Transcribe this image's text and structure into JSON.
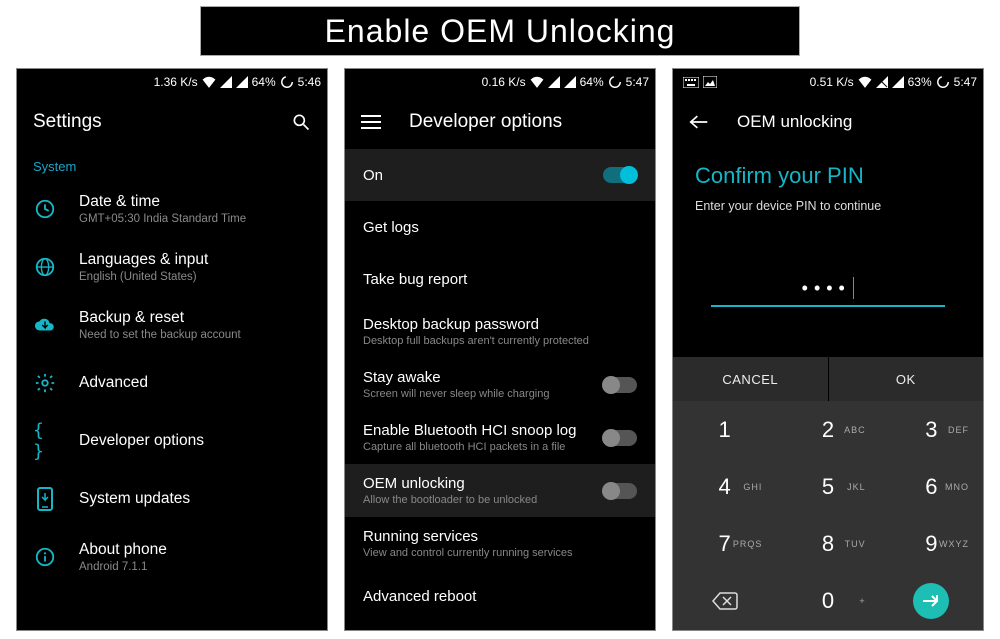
{
  "banner": {
    "title": "Enable OEM Unlocking"
  },
  "accent": "#15b6c7",
  "screen1": {
    "status": {
      "speed": "1.36 K/s",
      "battery": "64%",
      "time": "5:46"
    },
    "title": "Settings",
    "section": "System",
    "items": [
      {
        "label": "Date & time",
        "sub": "GMT+05:30 India Standard Time",
        "icon": "clock-icon"
      },
      {
        "label": "Languages & input",
        "sub": "English (United States)",
        "icon": "globe-icon"
      },
      {
        "label": "Backup & reset",
        "sub": "Need to set the backup account",
        "icon": "cloud-icon"
      },
      {
        "label": "Advanced",
        "sub": "",
        "icon": "gear-icon"
      },
      {
        "label": "Developer options",
        "sub": "",
        "icon": "braces-icon"
      },
      {
        "label": "System updates",
        "sub": "",
        "icon": "update-icon"
      },
      {
        "label": "About phone",
        "sub": "Android 7.1.1",
        "icon": "info-icon"
      }
    ]
  },
  "screen2": {
    "status": {
      "speed": "0.16 K/s",
      "battery": "64%",
      "time": "5:47"
    },
    "title": "Developer options",
    "items": [
      {
        "label": "On",
        "sub": "",
        "toggle": "on",
        "highlight": true
      },
      {
        "label": "Get logs",
        "sub": ""
      },
      {
        "label": "Take bug report",
        "sub": ""
      },
      {
        "label": "Desktop backup password",
        "sub": "Desktop full backups aren't currently protected"
      },
      {
        "label": "Stay awake",
        "sub": "Screen will never sleep while charging",
        "toggle": "off"
      },
      {
        "label": "Enable Bluetooth HCI snoop log",
        "sub": "Capture all bluetooth HCI packets in a file",
        "toggle": "off"
      },
      {
        "label": "OEM unlocking",
        "sub": "Allow the bootloader to be unlocked",
        "toggle": "off",
        "highlight": true
      },
      {
        "label": "Running services",
        "sub": "View and control currently running services"
      },
      {
        "label": "Advanced reboot",
        "sub": ""
      }
    ]
  },
  "screen3": {
    "status": {
      "speed": "0.51 K/s",
      "battery": "63%",
      "time": "5:47"
    },
    "title": "OEM unlocking",
    "confirm_title": "Confirm your PIN",
    "confirm_sub": "Enter your device PIN to continue",
    "pin_mask": "••••",
    "cancel": "CANCEL",
    "ok": "OK",
    "keys": [
      {
        "d": "1",
        "l": ""
      },
      {
        "d": "2",
        "l": "ABC"
      },
      {
        "d": "3",
        "l": "DEF"
      },
      {
        "d": "4",
        "l": "GHI"
      },
      {
        "d": "5",
        "l": "JKL"
      },
      {
        "d": "6",
        "l": "MNO"
      },
      {
        "d": "7",
        "l": "PRQS"
      },
      {
        "d": "8",
        "l": "TUV"
      },
      {
        "d": "9",
        "l": "WXYZ"
      },
      {
        "d": "back",
        "l": ""
      },
      {
        "d": "0",
        "l": "+"
      },
      {
        "d": "enter",
        "l": ""
      }
    ]
  }
}
